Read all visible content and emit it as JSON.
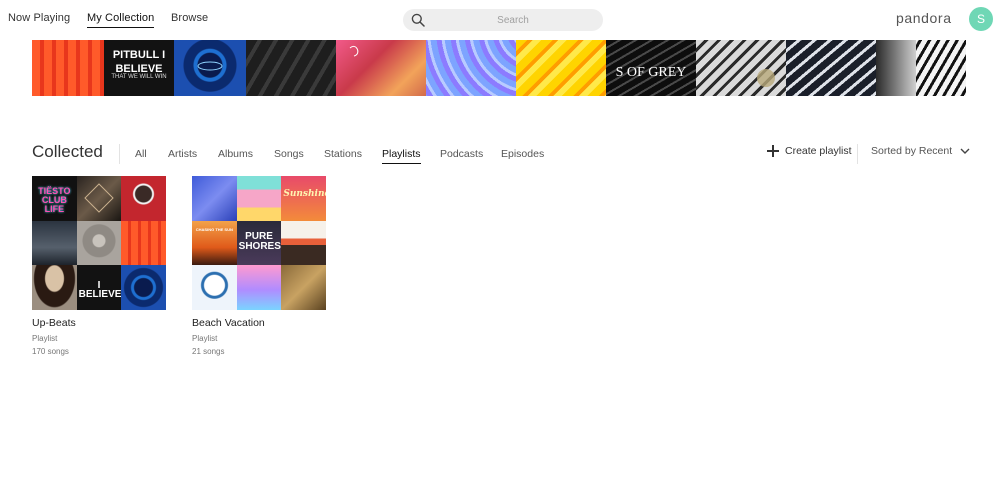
{
  "nav": {
    "now_playing": "Now Playing",
    "my_collection": "My Collection",
    "browse": "Browse"
  },
  "search": {
    "placeholder": "Search"
  },
  "brand": {
    "logo": "pandora",
    "avatar_initial": "S",
    "avatar_color": "#6fd7b5"
  },
  "recent_strip": [
    {
      "label": "",
      "sub": "",
      "icon": "orange-stripes-art"
    },
    {
      "label": "PITBULL I BELIEVE",
      "sub": "THAT WE WILL WIN",
      "icon": "pitbull-cover"
    },
    {
      "label": "",
      "sub": "",
      "icon": "blue-circle-art"
    },
    {
      "label": "",
      "sub": "",
      "icon": "dark-stripes-art"
    },
    {
      "label": "",
      "sub": "",
      "icon": "abstract-art"
    },
    {
      "label": "",
      "sub": "",
      "icon": "blue-wave-art"
    },
    {
      "label": "",
      "sub": "",
      "icon": "yellow-sun-art"
    },
    {
      "label": "S OF GREY",
      "sub": "",
      "icon": "grey-stripes-art"
    },
    {
      "label": "",
      "sub": "",
      "icon": "grey-face-art"
    },
    {
      "label": "",
      "sub": "",
      "icon": "striped-portrait-art"
    },
    {
      "label": "",
      "sub": "",
      "icon": "bw-stripes-art"
    }
  ],
  "collection": {
    "title": "Collected",
    "filters": [
      "All",
      "Artists",
      "Albums",
      "Songs",
      "Stations",
      "Playlists",
      "Podcasts",
      "Episodes"
    ],
    "active_filter": "Playlists",
    "create_label": "Create playlist",
    "sort_label": "Sorted by Recent"
  },
  "playlists": [
    {
      "title": "Up-Beats",
      "type": "Playlist",
      "count": "170 songs",
      "covers": [
        {
          "text": "TIËSTO CLUB LIFE",
          "icon": "tiesto-cover"
        },
        {
          "text": "",
          "icon": "diamond-cover"
        },
        {
          "text": "",
          "icon": "red-portrait-cover"
        },
        {
          "text": "",
          "icon": "city-cover"
        },
        {
          "text": "",
          "icon": "grey-figure-cover"
        },
        {
          "text": "",
          "icon": "orange-stripes-cover"
        },
        {
          "text": "",
          "icon": "sia-cover"
        },
        {
          "text": "I BELIEVE",
          "icon": "pitbull-cover"
        },
        {
          "text": "",
          "icon": "blue-circle-cover"
        }
      ]
    },
    {
      "title": "Beach Vacation",
      "type": "Playlist",
      "count": "21 songs",
      "covers": [
        {
          "text": "",
          "icon": "blue-collage-cover"
        },
        {
          "text": "",
          "icon": "pastel-boxes-cover"
        },
        {
          "text": "Sunshine",
          "icon": "sunshine-cover"
        },
        {
          "text": "CHASING THE SUN",
          "icon": "sunset-cover"
        },
        {
          "text": "PURE SHORES",
          "icon": "pure-shores-cover"
        },
        {
          "text": "",
          "icon": "orange-stripe-cover"
        },
        {
          "text": "",
          "icon": "illustrated-face-cover"
        },
        {
          "text": "",
          "icon": "pink-landscape-cover"
        },
        {
          "text": "",
          "icon": "band-photo-cover"
        }
      ]
    }
  ]
}
